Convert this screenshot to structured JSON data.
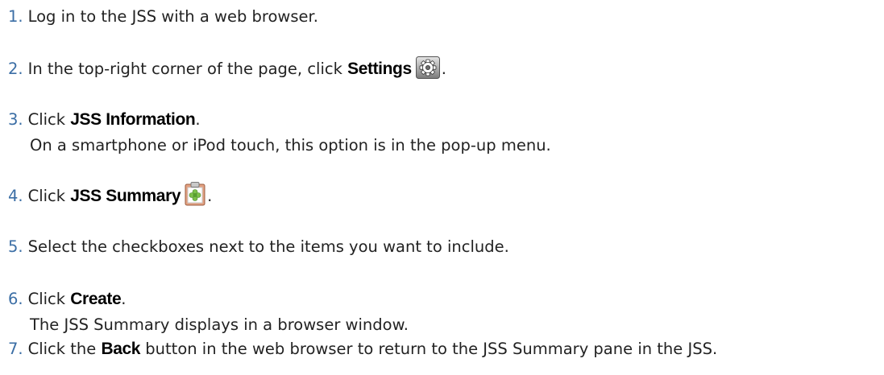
{
  "steps": [
    {
      "num": "1.",
      "pre": "Log in to the JSS with a web browser."
    },
    {
      "num": "2.",
      "pre": "In the top-right corner of the page, click ",
      "emph": "Settings",
      "icon": "gear-icon",
      "post": "."
    },
    {
      "num": "3.",
      "pre": "Click ",
      "emph": "JSS Information",
      "post": ".",
      "sub": "On a smartphone or iPod touch, this option is in the pop-up menu."
    },
    {
      "num": "4.",
      "pre": "Click ",
      "emph": "JSS Summary",
      "icon": "clipboard-icon",
      "post": "."
    },
    {
      "num": "5.",
      "pre": "Select the checkboxes next to the items you want to include."
    },
    {
      "num": "6.",
      "pre": "Click ",
      "emph": "Create",
      "post": ".",
      "sub": "The JSS Summary displays in a browser window."
    },
    {
      "num": "7.",
      "pre": "Click the ",
      "emph": "Back",
      "post": " button in the web browser to return to the JSS Summary pane in the JSS."
    }
  ],
  "colors": {
    "step_number": "#3b6ea5",
    "text": "#222222",
    "emphasis": "#000000"
  }
}
